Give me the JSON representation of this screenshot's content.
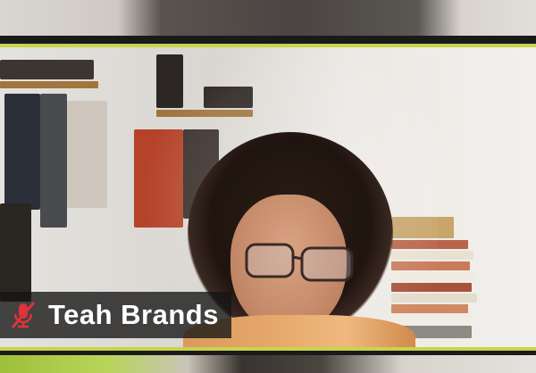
{
  "meeting": {
    "active_speaker": {
      "name": "Teah Brands",
      "mic_state": "muted",
      "mic_icon": "mic-muted-icon",
      "highlight_color": "#c8d44a",
      "label_background": "#141414"
    }
  }
}
